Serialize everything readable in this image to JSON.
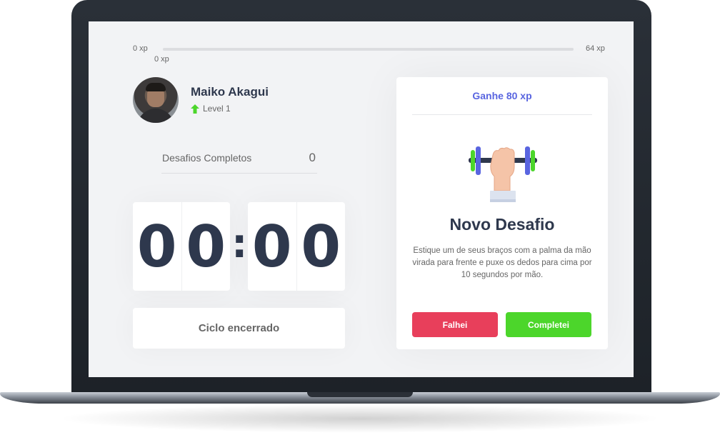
{
  "xp_bar": {
    "start_label": "0 xp",
    "end_label": "64 xp",
    "current_label": "0 xp",
    "progress": 0
  },
  "profile": {
    "name": "Maiko Akagui",
    "level_label": "Level 1"
  },
  "challenges_completed": {
    "label": "Desafios Completos",
    "count": "0"
  },
  "countdown": {
    "minute_left": "0",
    "minute_right": "0",
    "separator": ":",
    "second_left": "0",
    "second_right": "0"
  },
  "cycle_button": {
    "label": "Ciclo encerrado"
  },
  "challenge_card": {
    "header": "Ganhe 80 xp",
    "icon": "dumbbell-icon",
    "title": "Novo Desafio",
    "description": "Estique um de seus braços com a palma da mão virada para frente e puxe os dedos para cima por 10 segundos por mão.",
    "fail_label": "Falhei",
    "complete_label": "Completei"
  },
  "colors": {
    "accent": "#5965e0",
    "fail": "#e83f5b",
    "success": "#4cd62b",
    "level_arrow": "#4cd62b",
    "text_dark": "#2e384d"
  }
}
